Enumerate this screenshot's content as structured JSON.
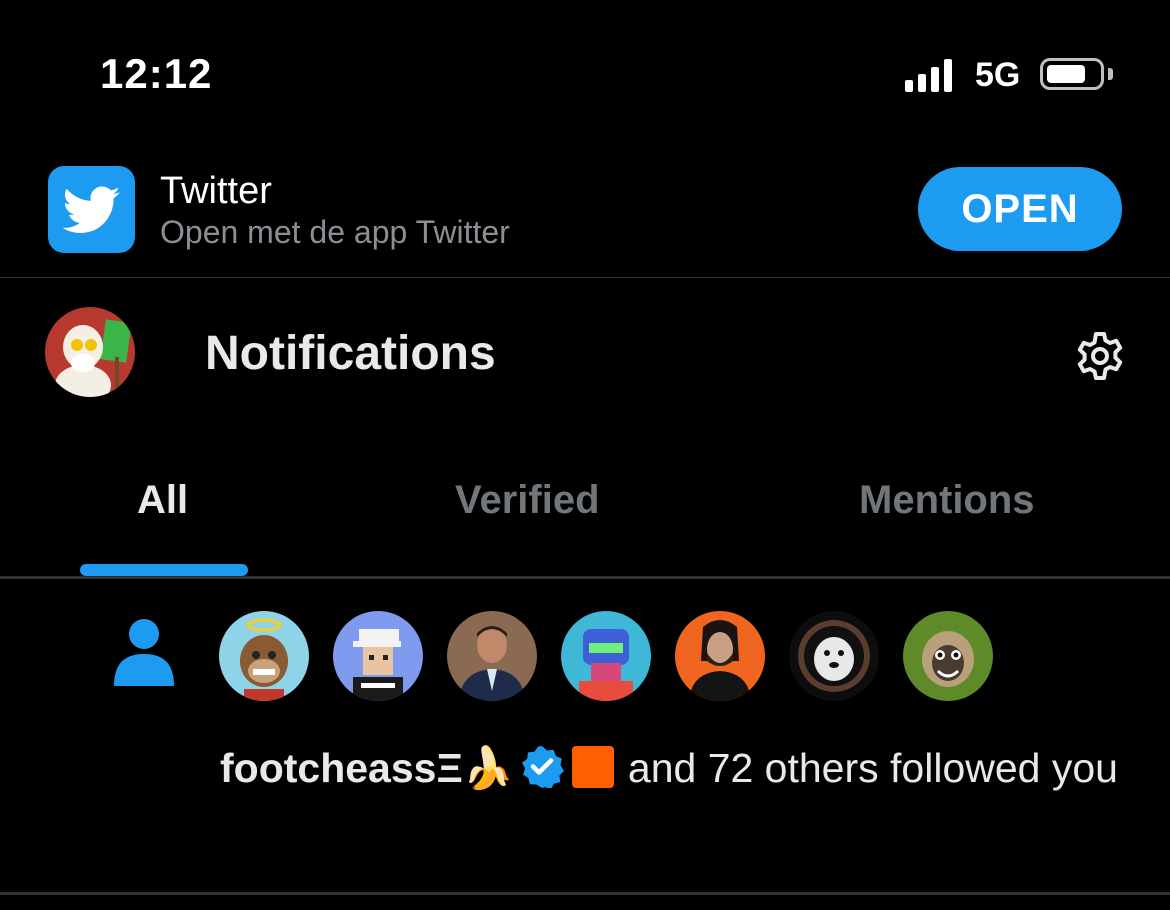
{
  "status_bar": {
    "time": "12:12",
    "network": "5G"
  },
  "app_banner": {
    "app_name": "Twitter",
    "subtitle": "Open met de app Twitter",
    "open_label": "OPEN",
    "icon": "twitter-bird-icon"
  },
  "header": {
    "title": "Notifications",
    "settings_icon": "gear-icon"
  },
  "tabs": [
    {
      "label": "All",
      "selected": true
    },
    {
      "label": "Verified",
      "selected": false
    },
    {
      "label": "Mentions",
      "selected": false
    }
  ],
  "notification": {
    "type_icon": "person-icon",
    "follower_avatars": [
      "ape-avatar",
      "pixel-avatar",
      "man-avatar",
      "robot-avatar",
      "john-wick-avatar",
      "dog-avatar",
      "monkey-avatar"
    ],
    "name": "footcheassΞ🍌",
    "text": "and 72 others followed you"
  },
  "colors": {
    "accent": "#1d9bf0",
    "background": "#000000",
    "orange_badge": "#ff5f00"
  }
}
